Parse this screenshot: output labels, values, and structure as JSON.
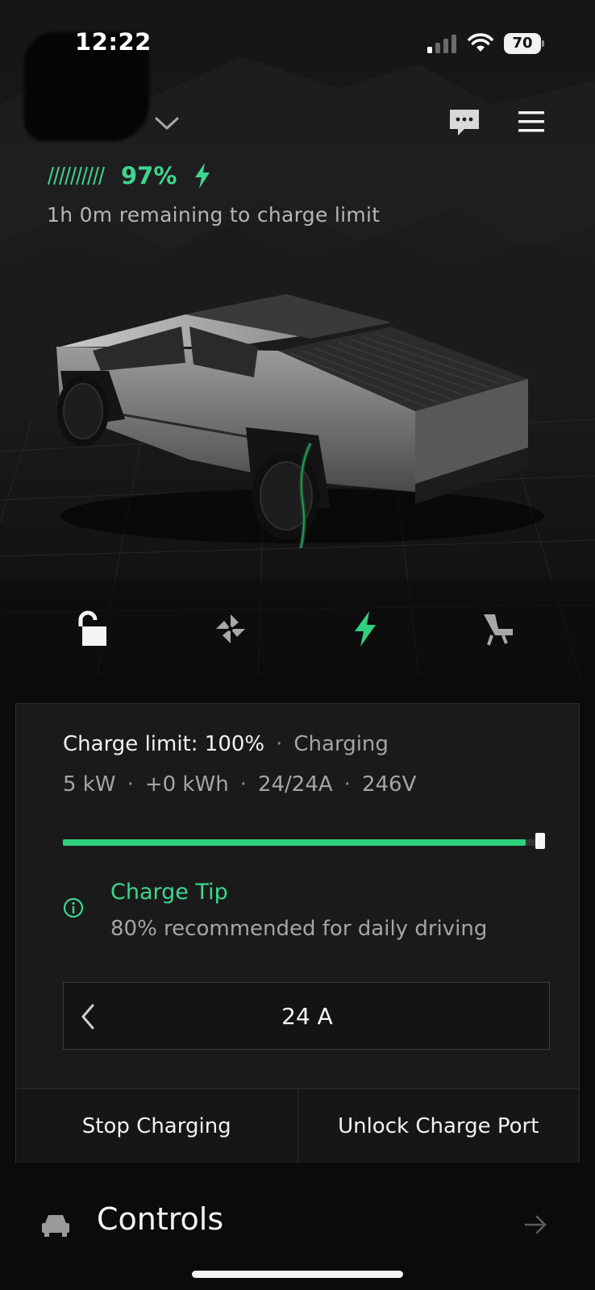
{
  "status_bar": {
    "time": "12:22",
    "battery_level": "70"
  },
  "header": {
    "battery_percent": "97%",
    "charge_remaining": "1h 0m remaining to charge limit"
  },
  "quick_actions": [
    {
      "icon": "unlock-icon"
    },
    {
      "icon": "fan-icon"
    },
    {
      "icon": "bolt-icon"
    },
    {
      "icon": "seat-icon"
    }
  ],
  "charging": {
    "limit_label": "Charge limit: 100%",
    "status": "Charging",
    "stats": [
      "5 kW",
      "+0 kWh",
      "24/24A",
      "246V"
    ],
    "charge_level": 0.97,
    "charge_limit": 1.0,
    "tip_title": "Charge Tip",
    "tip_text": "80% recommended for daily driving",
    "amperage": "24 A",
    "stop_label": "Stop Charging",
    "unlock_label": "Unlock Charge Port"
  },
  "nav": {
    "controls_label": "Controls"
  },
  "colors": {
    "accent_green": "#3dd68c",
    "background": "#0b0b0c",
    "card": "#1a1a1b"
  }
}
